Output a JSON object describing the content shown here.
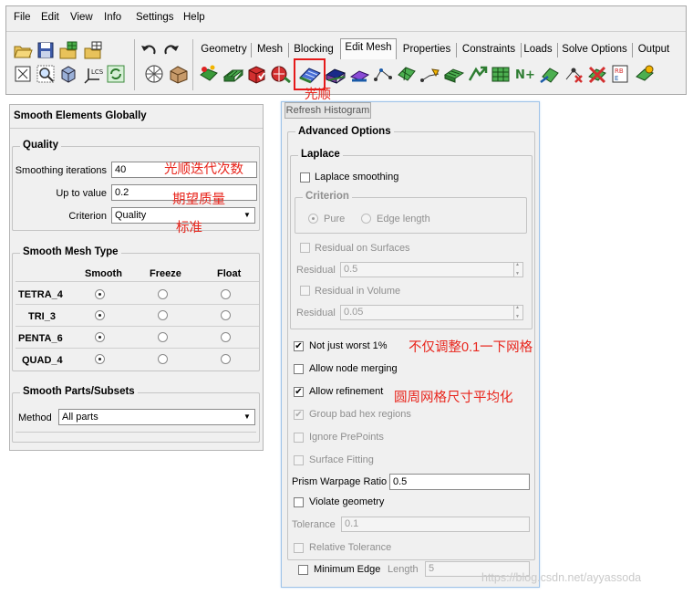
{
  "menu": [
    "File",
    "Edit",
    "View",
    "Info",
    "Settings",
    "Help"
  ],
  "tabs": [
    "Geometry",
    "Mesh",
    "Blocking",
    "Edit Mesh",
    "Properties",
    "Constraints",
    "Loads",
    "Solve Options",
    "Output"
  ],
  "active_tab": "Edit Mesh",
  "toolbar_left_icons": [
    "open-icon",
    "save-icon",
    "geometry-open-icon",
    "geometry-save-icon",
    "undo-icon",
    "redo-icon",
    "fit-window-icon",
    "zoom-box-icon",
    "view-cube-icon",
    "local-coord-icon",
    "refresh-icon",
    "wireframe-icon",
    "solid-shaded-icon"
  ],
  "edit_mesh_icons": [
    "create-elements-icon",
    "extrude-mesh-icon",
    "check-mesh-icon",
    "display-quality-icon",
    "smooth-mesh-icon",
    "smooth-hexa-icon",
    "repair-mesh-icon",
    "merge-nodes-icon",
    "split-mesh-icon",
    "move-nodes-icon",
    "transform-mesh-icon",
    "convert-mesh-type-icon",
    "adjust-mesh-icon",
    "renumber-mesh-icon",
    "reorient-mesh-icon",
    "delete-nodes-icon",
    "delete-elements-icon",
    "edit-distributed-icon"
  ],
  "annotations": {
    "smooth_icon": "光顺",
    "iterations": "光顺迭代次数",
    "target_quality": "期望质量",
    "criterion": "标准",
    "not_just_worst": "不仅调整0.1一下网格",
    "allow_refinement": "圆周网格尺寸平均化"
  },
  "left_panel": {
    "title": "Smooth Elements Globally",
    "quality": {
      "title": "Quality",
      "iterations_label": "Smoothing iterations",
      "iterations_value": "40",
      "up_to_label": "Up to value",
      "up_to_value": "0.2",
      "criterion_label": "Criterion",
      "criterion_value": "Quality"
    },
    "mesh_type": {
      "title": "Smooth Mesh Type",
      "columns": [
        "Smooth",
        "Freeze",
        "Float"
      ],
      "rows": [
        {
          "label": "TETRA_4",
          "selected": "Smooth"
        },
        {
          "label": "TRI_3",
          "selected": "Smooth"
        },
        {
          "label": "PENTA_6",
          "selected": "Smooth"
        },
        {
          "label": "QUAD_4",
          "selected": "Smooth"
        }
      ]
    },
    "parts": {
      "title": "Smooth Parts/Subsets",
      "method_label": "Method",
      "method_value": "All parts"
    }
  },
  "right_panel": {
    "refresh_button": "Refresh Histogram",
    "advanced_title": "Advanced Options",
    "laplace": {
      "title": "Laplace",
      "laplace_smoothing": "Laplace smoothing",
      "criterion_title": "Criterion",
      "pure": "Pure",
      "edge_length": "Edge length",
      "residual_surfaces": "Residual on Surfaces",
      "residual_label": "Residual",
      "residual_surfaces_value": "0.5",
      "residual_volume": "Residual in Volume",
      "residual_volume_value": "0.05"
    },
    "not_just_worst": "Not just worst 1%",
    "allow_node_merging": "Allow node merging",
    "allow_refinement": "Allow refinement",
    "group_bad_hex": "Group bad hex regions",
    "ignore_preprints": "Ignore PrePoints",
    "surface_fitting": "Surface Fitting",
    "prism_warpage_label": "Prism Warpage Ratio",
    "prism_warpage_value": "0.5",
    "violate_geometry": "Violate geometry",
    "tolerance_label": "Tolerance",
    "tolerance_value": "0.1",
    "relative_tolerance": "Relative Tolerance",
    "minimum_edge": "Minimum Edge",
    "length_label": "Length",
    "length_value": "5"
  },
  "watermark": "https://blog.csdn.net/ayyassoda",
  "colors": {
    "annotation_red": "#e8241b",
    "panel_bg": "#f0f0f0",
    "highlight_red": "#e51a1a"
  }
}
